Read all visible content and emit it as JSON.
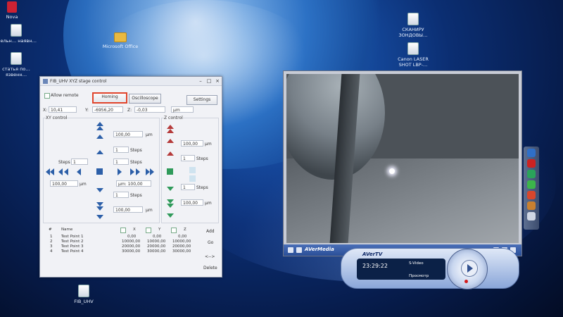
{
  "desktop": {
    "icons": [
      {
        "label": "Nova",
        "kind": "doc"
      },
      {
        "label": "…ельн… наявн…",
        "kind": "doc"
      },
      {
        "label": "статья по…\nязвенн…",
        "kind": "doc"
      },
      {
        "label": "Microsoft Office",
        "kind": "folder"
      },
      {
        "label": "СКАНИРУ ЗОНДОВЫ…",
        "kind": "doc"
      },
      {
        "label": "Canon LASER SHOT LBP-…",
        "kind": "doc"
      },
      {
        "label": "FIB_UHV",
        "kind": "doc"
      }
    ]
  },
  "stage_window": {
    "title": "FIB_UHV XYZ stage control",
    "allow_remote": "Allow remote",
    "homing": "Homing",
    "oscilloscope": "Oscilloscope",
    "settings": "Settings",
    "x_label": "X:",
    "x_value": "10,41",
    "y_label": "Y:",
    "y_value": "-6956,20",
    "z_label": "Z:",
    "z_value": "-0,03",
    "unit": "µm",
    "xy_control": "XY control",
    "z_control": "Z control",
    "steps_label": "Steps",
    "steps_value": "1",
    "xy_um_top": "100,00",
    "xy_steps_top": "1",
    "xy_steps_mid": "1",
    "xy_um_left": "100,00",
    "xy_um_right": "µm: 100,00",
    "xy_steps_bottom": "1",
    "xy_um_bottom": "100,00",
    "um_unit": "µm",
    "steps_unit": "Steps",
    "z_um_top": "100,00",
    "z_steps_top": "1",
    "z_steps_bottom": "1",
    "z_um_bottom": "100,00",
    "table": {
      "headers": [
        "#",
        "Name",
        "X",
        "Y",
        "Z"
      ],
      "rows": [
        {
          "n": "1",
          "name": "Test Point 1",
          "x": "0,00",
          "y": "0,00",
          "z": "0,00"
        },
        {
          "n": "2",
          "name": "Test Point 2",
          "x": "10000,00",
          "y": "10000,00",
          "z": "10000,00"
        },
        {
          "n": "3",
          "name": "Test Point 3",
          "x": "20000,00",
          "y": "20000,00",
          "z": "20000,00"
        },
        {
          "n": "4",
          "name": "Test Point 4",
          "x": "30000,00",
          "y": "30000,00",
          "z": "30000,00"
        }
      ],
      "add": "Add",
      "go": "Go",
      "swap": "<-->",
      "delete": "Delete"
    }
  },
  "video_window": {
    "brand": "AVerMedia"
  },
  "avertv": {
    "logo": "AVerTV",
    "time": "23:29:22",
    "source": "S-Video",
    "view": "Просмотр"
  }
}
